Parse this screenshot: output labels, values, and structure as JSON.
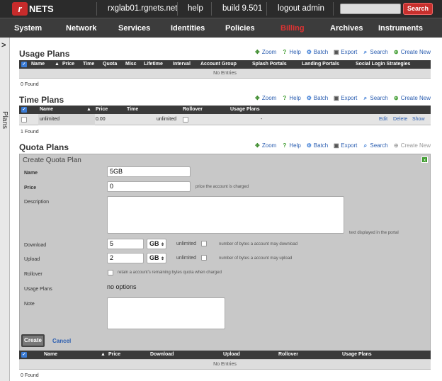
{
  "top": {
    "logo_text": "NETS",
    "hostname": "rxglab01.rgnets.net",
    "help": "help",
    "build": "build 9.501",
    "logout": "logout admin",
    "search_button": "Search"
  },
  "nav": [
    "System",
    "Network",
    "Services",
    "Identities",
    "Policies",
    "Billing",
    "Archives",
    "Instruments"
  ],
  "sidebar": {
    "label": "Plans",
    "toggle": ">"
  },
  "usage_plans": {
    "title": "Usage Plans",
    "actions": [
      "Zoom",
      "Help",
      "Batch",
      "Export",
      "Search",
      "Create New"
    ],
    "columns": [
      "Name",
      "Price",
      "Time",
      "Quota",
      "Misc",
      "Lifetime",
      "Interval",
      "Account Group",
      "Splash Portals",
      "Landing Portals",
      "Social Login Strategies"
    ],
    "empty": "No Entries",
    "found": "0 Found"
  },
  "time_plans": {
    "title": "Time Plans",
    "actions": [
      "Zoom",
      "Help",
      "Batch",
      "Export",
      "Search",
      "Create New"
    ],
    "columns": [
      "Name",
      "Price",
      "Time",
      "Rollover",
      "Usage Plans"
    ],
    "row": {
      "name": "unlimited",
      "price": "0.00",
      "time": "unlimited",
      "usage_plans": "-",
      "edit": "Edit",
      "delete": "Delete",
      "show": "Show"
    },
    "found": "1 Found"
  },
  "quota_plans": {
    "title": "Quota Plans",
    "actions": [
      "Zoom",
      "Help",
      "Batch",
      "Export",
      "Search",
      "Create New"
    ],
    "columns": [
      "Name",
      "Price",
      "Download",
      "Upload",
      "Rollover",
      "Usage Plans"
    ],
    "empty": "No Entries",
    "found": "0 Found"
  },
  "form": {
    "title": "Create Quota Plan",
    "close": "x",
    "name_label": "Name",
    "name_value": "5GB",
    "price_label": "Price",
    "price_value": "0",
    "price_hint": "price the account is charged",
    "description_label": "Description",
    "description_hint": "text displayed in the portal",
    "download_label": "Download",
    "download_value": "5",
    "download_unit": "GB",
    "download_unlimited": "unlimited",
    "download_hint": "number of bytes a account may download",
    "upload_label": "Upload",
    "upload_value": "2",
    "upload_unit": "GB",
    "upload_unlimited": "unlimited",
    "upload_hint": "number of bytes a account may upload",
    "rollover_label": "Rollover",
    "rollover_hint": "retain a account's remaining bytes quota when charged",
    "usage_plans_label": "Usage Plans",
    "usage_plans_value": "no options",
    "note_label": "Note",
    "create": "Create",
    "cancel": "Cancel"
  },
  "colors": {
    "accent": "#c7302d",
    "link": "#2a5db0",
    "header_bg": "#2b2b2b"
  }
}
